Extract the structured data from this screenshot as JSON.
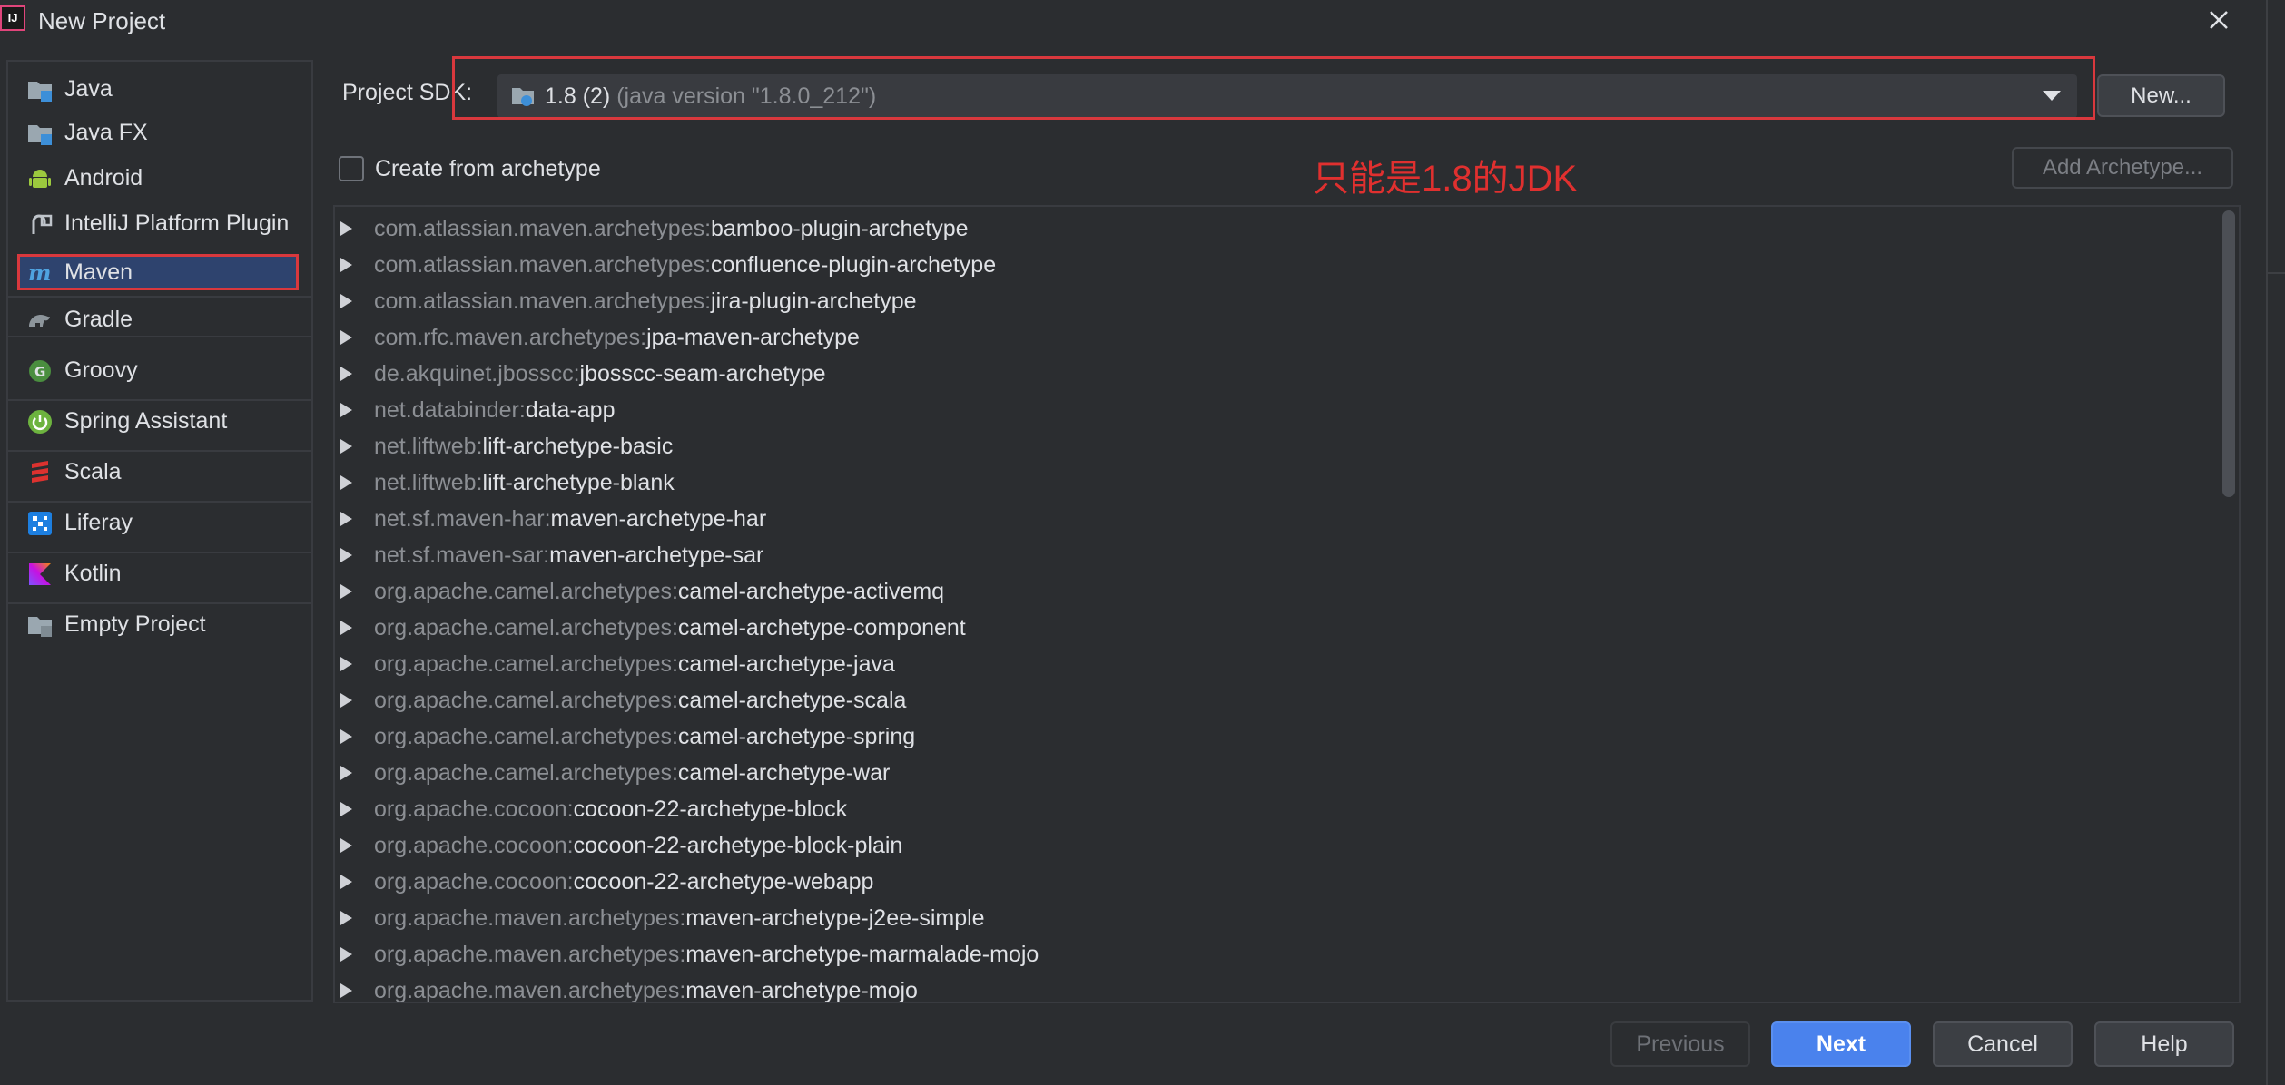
{
  "window": {
    "title": "New Project",
    "app_icon_text": "IJ"
  },
  "sidebar": {
    "items": [
      {
        "label": "Java",
        "icon": "folder-java-icon"
      },
      {
        "label": "Java FX",
        "icon": "folder-javafx-icon"
      },
      {
        "label": "Android",
        "icon": "android-icon"
      },
      {
        "label": "IntelliJ Platform Plugin",
        "icon": "plugin-icon"
      },
      {
        "label": "Maven",
        "icon": "maven-icon",
        "selected": true
      },
      {
        "label": "Gradle",
        "icon": "gradle-icon"
      },
      {
        "label": "Groovy",
        "icon": "groovy-icon"
      },
      {
        "label": "Spring Assistant",
        "icon": "spring-icon"
      },
      {
        "label": "Scala",
        "icon": "scala-icon"
      },
      {
        "label": "Liferay",
        "icon": "liferay-icon"
      },
      {
        "label": "Kotlin",
        "icon": "kotlin-icon"
      },
      {
        "label": "Empty Project",
        "icon": "folder-empty-icon"
      }
    ]
  },
  "sdk": {
    "label": "Project SDK:",
    "value_main": "1.8 (2)",
    "value_detail": "(java version \"1.8.0_212\")",
    "new_button": "New..."
  },
  "archetype": {
    "checkbox_label": "Create from archetype",
    "checked": false,
    "add_button": "Add Archetype..."
  },
  "annotation": "只能是1.8的JDK",
  "archetypes": [
    {
      "group": "com.atlassian.maven.archetypes:",
      "artifact": "bamboo-plugin-archetype"
    },
    {
      "group": "com.atlassian.maven.archetypes:",
      "artifact": "confluence-plugin-archetype"
    },
    {
      "group": "com.atlassian.maven.archetypes:",
      "artifact": "jira-plugin-archetype"
    },
    {
      "group": "com.rfc.maven.archetypes:",
      "artifact": "jpa-maven-archetype"
    },
    {
      "group": "de.akquinet.jbosscc:",
      "artifact": "jbosscc-seam-archetype"
    },
    {
      "group": "net.databinder:",
      "artifact": "data-app"
    },
    {
      "group": "net.liftweb:",
      "artifact": "lift-archetype-basic"
    },
    {
      "group": "net.liftweb:",
      "artifact": "lift-archetype-blank"
    },
    {
      "group": "net.sf.maven-har:",
      "artifact": "maven-archetype-har"
    },
    {
      "group": "net.sf.maven-sar:",
      "artifact": "maven-archetype-sar"
    },
    {
      "group": "org.apache.camel.archetypes:",
      "artifact": "camel-archetype-activemq"
    },
    {
      "group": "org.apache.camel.archetypes:",
      "artifact": "camel-archetype-component"
    },
    {
      "group": "org.apache.camel.archetypes:",
      "artifact": "camel-archetype-java"
    },
    {
      "group": "org.apache.camel.archetypes:",
      "artifact": "camel-archetype-scala"
    },
    {
      "group": "org.apache.camel.archetypes:",
      "artifact": "camel-archetype-spring"
    },
    {
      "group": "org.apache.camel.archetypes:",
      "artifact": "camel-archetype-war"
    },
    {
      "group": "org.apache.cocoon:",
      "artifact": "cocoon-22-archetype-block"
    },
    {
      "group": "org.apache.cocoon:",
      "artifact": "cocoon-22-archetype-block-plain"
    },
    {
      "group": "org.apache.cocoon:",
      "artifact": "cocoon-22-archetype-webapp"
    },
    {
      "group": "org.apache.maven.archetypes:",
      "artifact": "maven-archetype-j2ee-simple"
    },
    {
      "group": "org.apache.maven.archetypes:",
      "artifact": "maven-archetype-marmalade-mojo"
    },
    {
      "group": "org.apache.maven.archetypes:",
      "artifact": "maven-archetype-mojo"
    }
  ],
  "footer": {
    "previous": "Previous",
    "next": "Next",
    "cancel": "Cancel",
    "help": "Help"
  },
  "colors": {
    "background": "#2b2d30",
    "accent": "#4a82ed",
    "annotation_red": "#e0302f",
    "highlight_box": "#d9383d"
  }
}
